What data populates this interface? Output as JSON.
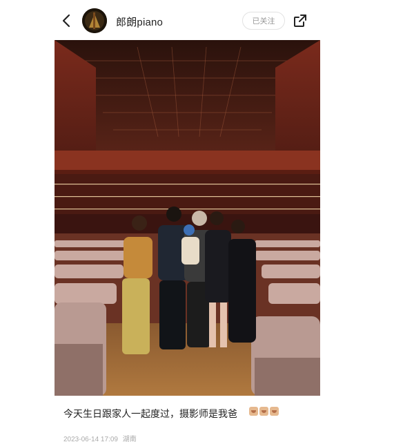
{
  "header": {
    "back_icon": "chevron-left-icon",
    "username": "郎朗piano",
    "follow_label": "已关注",
    "share_icon": "share-icon"
  },
  "post": {
    "caption": "今天生日跟家人一起度过，摄影师是我爸",
    "emojis": [
      "face-emoji",
      "face-emoji",
      "face-emoji"
    ],
    "date": "2023-06-14 17:09",
    "location": "湖南"
  },
  "colors": {
    "text_primary": "#222222",
    "text_muted": "#999999",
    "border": "#e2e2e2"
  }
}
